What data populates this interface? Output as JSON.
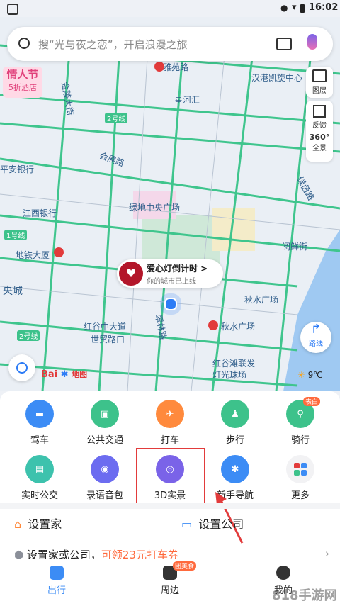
{
  "status": {
    "time": "16:02"
  },
  "search": {
    "placeholder": "搜“光与夜之恋”，开启浪漫之旅"
  },
  "map_tools": {
    "layers": "图层",
    "feedback": "反馈",
    "panorama": "全景",
    "panorama_badge": "360°"
  },
  "map_labels": {
    "valentine_line1": "情人节",
    "valentine_line2": "5折酒店",
    "yayuan_road": "雅苑路",
    "hanggang_center": "汉港凯旋中心",
    "jinlong_street": "金陵大街",
    "xinghe": "星河汇",
    "line2": "2号线",
    "huizhan_road": "会展路",
    "pingan_bank": "平安银行",
    "jiangxi_bank": "江西银行",
    "lvdi_plaza": "绿地中央广场",
    "line1": "1号线",
    "metro_building": "地铁大厦",
    "central_city": "央城",
    "cuilin_road": "翠林路",
    "hongguzhong_road": "红谷中大道",
    "trade_road": "世贸路口",
    "qiushui_plaza": "秋水广场",
    "qiushui_plaza_poi": "秋水广场",
    "yuelan_street": "阅鲜街",
    "lvyin_road": "绿茵路",
    "honggutan_1": "红谷滩联发",
    "honggutan_2": "灯光球场",
    "line2b": "2号线"
  },
  "promo": {
    "title": "爱心灯倒计时 >",
    "subtitle": "你的城市已上线"
  },
  "weather": "9℃",
  "route_button": "路线",
  "baidu_logo": "Bai",
  "baidu_logo_cn": "地图",
  "grid": [
    {
      "label": "驾车",
      "color": "#3c8cf5"
    },
    {
      "label": "公共交通",
      "color": "#3dc28b"
    },
    {
      "label": "打车",
      "color": "#ff8a3d"
    },
    {
      "label": "步行",
      "color": "#3dc28b"
    },
    {
      "label": "骑行",
      "color": "#3dc28b",
      "badge": "表白"
    },
    {
      "label": "实时公交",
      "color": "#3dc2ad"
    },
    {
      "label": "录语音包",
      "color": "#6c6cf0"
    },
    {
      "label": "3D实景",
      "color": "#7a63e8"
    },
    {
      "label": "新手导航",
      "color": "#3c8cf5"
    },
    {
      "label": "更多",
      "color": "#f2f2f4"
    }
  ],
  "places": {
    "home": "设置家",
    "company": "设置公司"
  },
  "coupon": {
    "text1": "设置家或公司，",
    "text2": "可领23元打车券",
    "chevron": "›"
  },
  "tabs": {
    "go": "出行",
    "nearby": "周边",
    "nearby_badge": "团美食",
    "mine": "我的"
  },
  "watermark": "818手游网",
  "colors": {
    "primary": "#3c8cf5",
    "route": "#3dc28b",
    "highlight": "#e23b3b"
  }
}
